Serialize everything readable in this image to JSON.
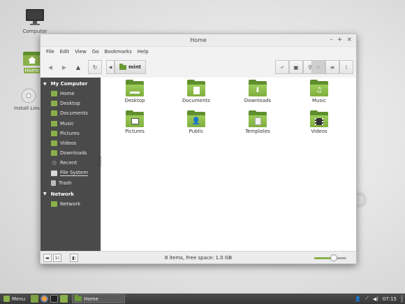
{
  "desktop": {
    "icons": [
      {
        "label": "Computer"
      },
      {
        "label": "Home"
      },
      {
        "label": "Install Linux Mint"
      }
    ]
  },
  "window": {
    "title": "Home",
    "menu": [
      "File",
      "Edit",
      "View",
      "Go",
      "Bookmarks",
      "Help"
    ],
    "location": "mint",
    "sidebar": {
      "sections": [
        {
          "title": "My Computer",
          "items": [
            "Home",
            "Desktop",
            "Documents",
            "Music",
            "Pictures",
            "Videos",
            "Downloads",
            "Recent",
            "File System",
            "Trash"
          ]
        },
        {
          "title": "Network",
          "items": [
            "Network"
          ]
        }
      ]
    },
    "files": [
      "Desktop",
      "Documents",
      "Downloads",
      "Music",
      "Pictures",
      "Public",
      "Templates",
      "Videos"
    ],
    "status": "8 items, Free space: 1.0 GB",
    "zoom_level": 0.6
  },
  "panel": {
    "menu_label": "Menu",
    "task_label": "Home",
    "time": "07:15"
  },
  "colors": {
    "accent": "#8ab04a",
    "sidebar_bg": "#4a4a4a",
    "panel_bg": "#3f3f3f"
  }
}
